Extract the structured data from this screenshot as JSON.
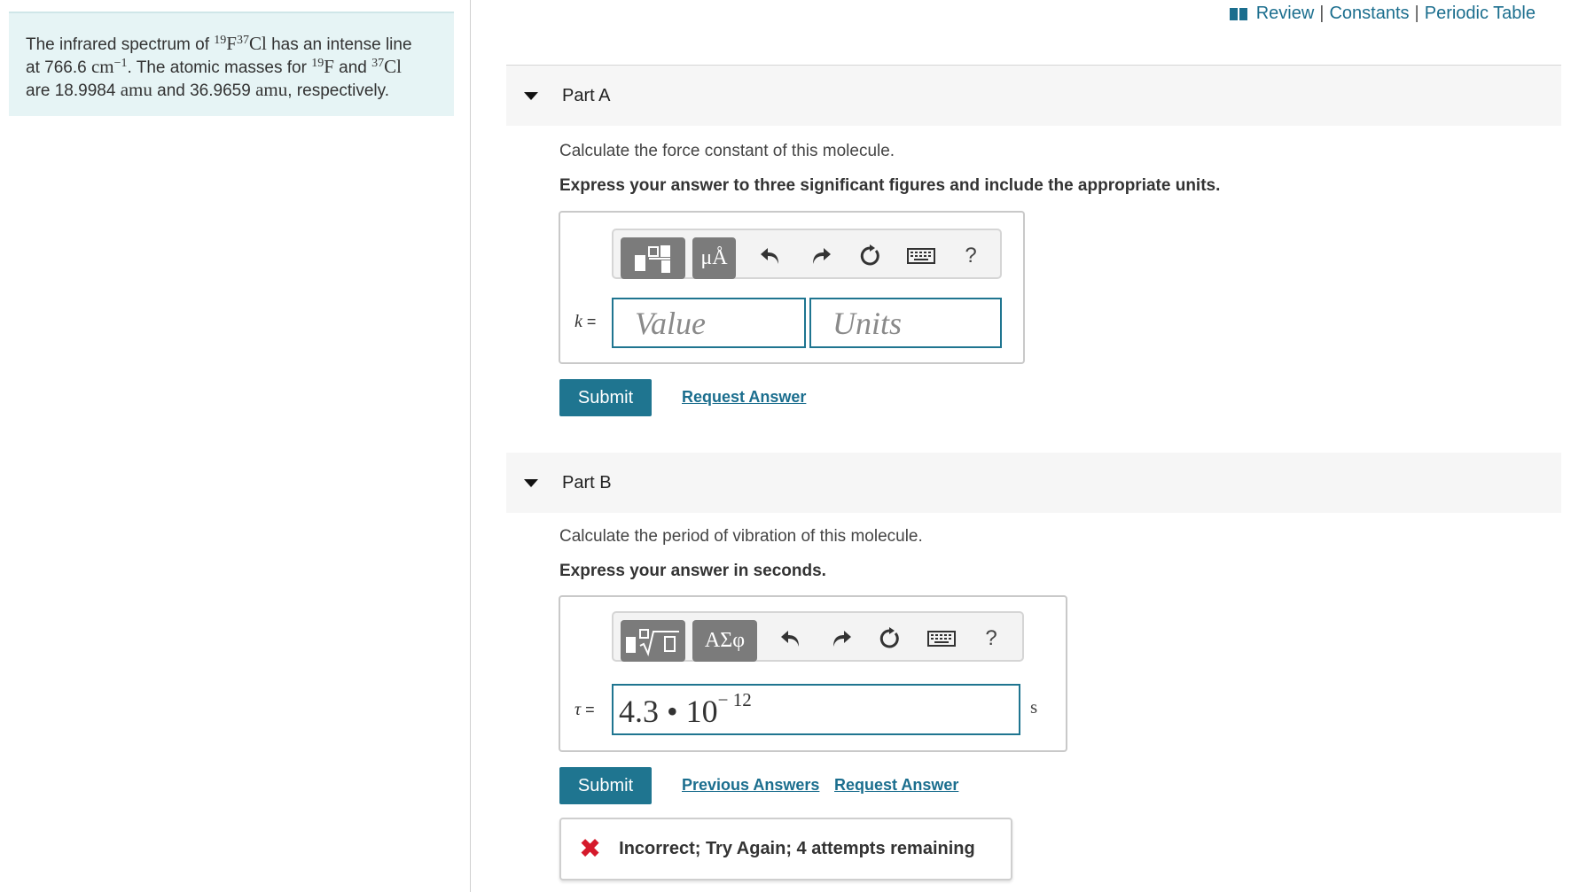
{
  "problem": {
    "text_1": "The infrared spectrum of",
    "iso_f_mass": "19",
    "iso_f_symbol": "F",
    "iso_cl_mass": "37",
    "iso_cl_symbol": "Cl",
    "text_2": "has an intense line",
    "text_3": "at 766.6",
    "unit_cm": "cm",
    "unit_cm_exp": "−1",
    "text_4": ". The atomic masses for",
    "text_5": "and",
    "text_6": "are 18.9984",
    "unit_amu_1": "amu",
    "text_7": "and 36.9659",
    "unit_amu_2": "amu",
    "text_8": ", respectively."
  },
  "top_links": {
    "book_icon": "book-icon",
    "review": "Review",
    "separator": "|",
    "constants": "Constants",
    "periodic_table": "Periodic Table"
  },
  "part_a": {
    "title": "Part A",
    "question": "Calculate the force constant of this molecule.",
    "instruction": "Express your answer to three significant figures and include the appropriate units.",
    "toolbar": {
      "templates_icon": "templates-icon",
      "units_button": "μÅ",
      "undo_icon": "undo-icon",
      "redo_icon": "redo-icon",
      "reset_icon": "reset-icon",
      "keyboard_icon": "keyboard-icon",
      "help_label": "?"
    },
    "variable": "k",
    "equals": "=",
    "value_placeholder": "Value",
    "units_placeholder": "Units",
    "submit_label": "Submit",
    "request_answer": "Request Answer"
  },
  "part_b": {
    "title": "Part B",
    "question": "Calculate the period of vibration of this molecule.",
    "instruction": "Express your answer in seconds.",
    "toolbar": {
      "templates_icon": "templates-radical-icon",
      "symbols_button": "ΑΣφ",
      "undo_icon": "undo-icon",
      "redo_icon": "redo-icon",
      "reset_icon": "reset-icon",
      "keyboard_icon": "keyboard-icon",
      "help_label": "?"
    },
    "variable": "τ",
    "equals": "=",
    "answer_mantissa": "4.3 • 10",
    "answer_exponent": "− 12",
    "unit_suffix": "s",
    "submit_label": "Submit",
    "previous_answers": "Previous Answers",
    "request_answer": "Request Answer",
    "feedback": "Incorrect; Try Again; 4 attempts remaining",
    "feedback_icon": "x-icon",
    "feedback_color": "#d51a2b"
  },
  "colors": {
    "accent": "#1f7590",
    "link": "#1b6e8e",
    "problem_bg": "#e6f4f5"
  }
}
